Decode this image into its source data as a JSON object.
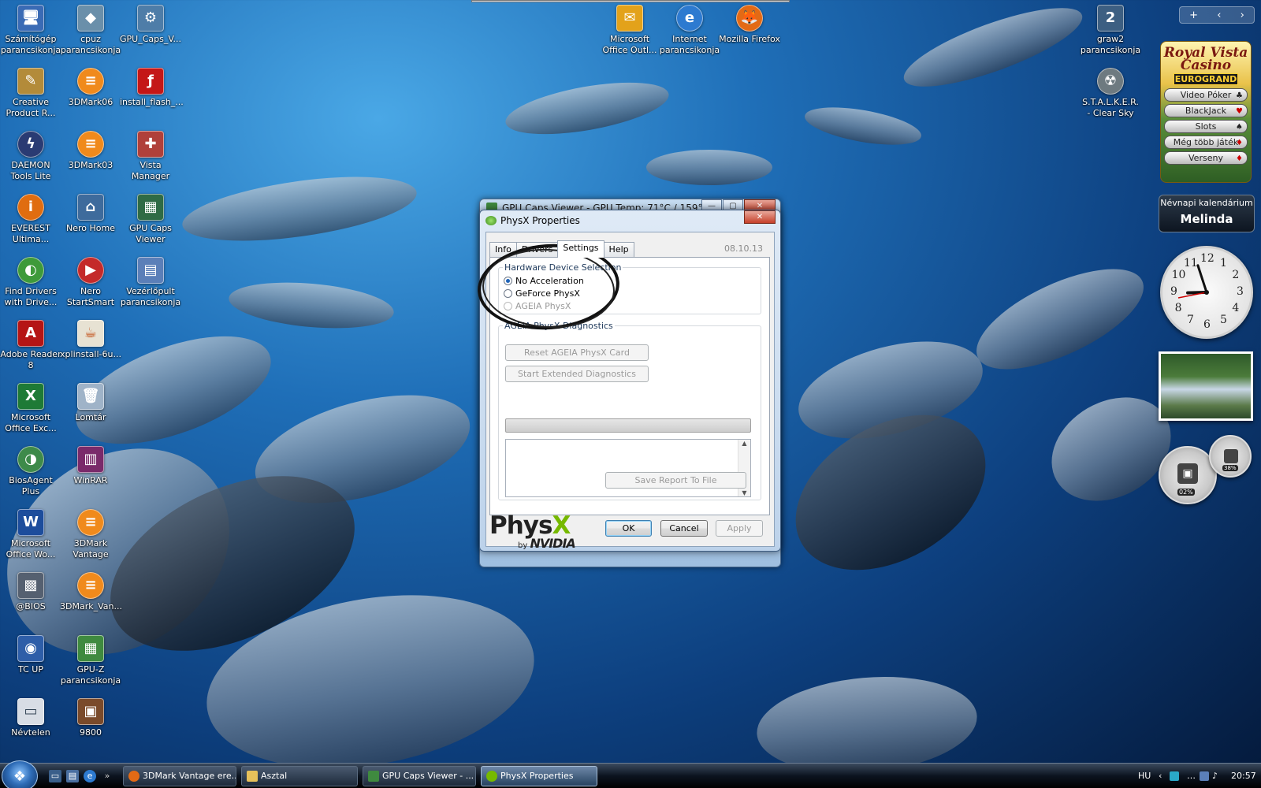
{
  "desktop_icons": [
    {
      "label": "Számítógép parancsikonja",
      "glyph": "🖥",
      "color": "#3a6bb5"
    },
    {
      "label": "cpuz parancsikonja",
      "glyph": "◆",
      "color": "#6a8faa"
    },
    {
      "label": "GPU_Caps_V...",
      "glyph": "⚙",
      "color": "#4e7da8"
    },
    {
      "label": "Creative Product R...",
      "glyph": "✎",
      "color": "#b38b3a"
    },
    {
      "label": "3DMark06",
      "glyph": "≡",
      "color": "#f08a1c"
    },
    {
      "label": "install_flash_...",
      "glyph": "ƒ",
      "color": "#c41717"
    },
    {
      "label": "DAEMON Tools Lite",
      "glyph": "ϟ",
      "color": "#2a3b73"
    },
    {
      "label": "3DMark03",
      "glyph": "≡",
      "color": "#f08a1c"
    },
    {
      "label": "Vista Manager",
      "glyph": "✚",
      "color": "#b0403a"
    },
    {
      "label": "EVEREST Ultima...",
      "glyph": "i",
      "color": "#e06d10"
    },
    {
      "label": "Nero Home",
      "glyph": "⌂",
      "color": "#3e6b9c"
    },
    {
      "label": "GPU Caps Viewer",
      "glyph": "▦",
      "color": "#2f6b45"
    },
    {
      "label": "Find Drivers with Drive...",
      "glyph": "◐",
      "color": "#3e9a3a"
    },
    {
      "label": "Nero StartSmart",
      "glyph": "▶",
      "color": "#c42a2a"
    },
    {
      "label": "Vezérlőpult parancsikonja",
      "glyph": "▤",
      "color": "#5b7fb8"
    },
    {
      "label": "Adobe Reader 8",
      "glyph": "A",
      "color": "#b51515"
    },
    {
      "label": "xplinstall-6u...",
      "glyph": "☕",
      "color": "#e7e2d3"
    },
    {
      "label": "Microsoft Office Exc...",
      "glyph": "X",
      "color": "#1e7a36"
    },
    {
      "label": "Lomtár",
      "glyph": "🗑",
      "color": "#9fb3c8"
    },
    {
      "label": "BiosAgent Plus",
      "glyph": "◑",
      "color": "#3e8a4a"
    },
    {
      "label": "WinRAR",
      "glyph": "▥",
      "color": "#7a2a6a"
    },
    {
      "label": "Microsoft Office Wo...",
      "glyph": "W",
      "color": "#1d4d9c"
    },
    {
      "label": "3DMark Vantage",
      "glyph": "≡",
      "color": "#f08a1c"
    },
    {
      "label": "@BIOS",
      "glyph": "▩",
      "color": "#556070"
    },
    {
      "label": "3DMark_Van...",
      "glyph": "≡",
      "color": "#f08a1c"
    },
    {
      "label": "TC UP",
      "glyph": "◉",
      "color": "#2e5ea8"
    },
    {
      "label": "GPU-Z parancsikonja",
      "glyph": "▦",
      "color": "#3f8a3f"
    },
    {
      "label": "Névtelen",
      "glyph": "▭",
      "color": "#d8dde5"
    },
    {
      "label": "9800",
      "glyph": "▣",
      "color": "#7a4a2a"
    }
  ],
  "top_icons": [
    {
      "label": "Microsoft Office Outl...",
      "glyph": "✉",
      "color": "#e3a21a"
    },
    {
      "label": "Internet parancsikonja",
      "glyph": "e",
      "color": "#2d7ad0"
    },
    {
      "label": "Mozilla Firefox",
      "glyph": "🦊",
      "color": "#e36a15"
    }
  ],
  "right_icons": [
    {
      "label": "graw2 parancsikonja",
      "glyph": "2",
      "color": "#3d5f82"
    },
    {
      "label": "S.T.A.L.K.E.R. - Clear Sky",
      "glyph": "☢",
      "color": "#6e7a80"
    }
  ],
  "sidebar": {
    "controls": {
      "add": "+",
      "prev": "‹",
      "next": "›"
    },
    "casino": {
      "title": "Royal Vista Casino",
      "brand": "EUROGRAND",
      "buttons": [
        {
          "label": "Video Póker",
          "suit": "♣"
        },
        {
          "label": "BlackJack",
          "suit": "♥"
        },
        {
          "label": "Slots",
          "suit": "♠"
        },
        {
          "label": "Még több játék",
          "suit": "♦"
        },
        {
          "label": "Verseny",
          "suit": "♦"
        }
      ]
    },
    "nevnap": {
      "title": "Névnapi kalendárium",
      "name": "Melinda"
    },
    "clock": {
      "numbers": [
        "12",
        "1",
        "2",
        "3",
        "4",
        "5",
        "6",
        "7",
        "8",
        "9",
        "10",
        "11"
      ],
      "hour": 8,
      "minute": 57
    },
    "meters": {
      "cpu": "02%",
      "ram": "38%"
    }
  },
  "back_window": {
    "title": "GPU Caps Viewer - GPU Temp: 71°C / 159°F",
    "minimize": "—",
    "maximize": "▢",
    "close": "✕"
  },
  "dialog": {
    "title": "PhysX Properties",
    "close": "✕",
    "tabs": [
      "Info",
      "Drivers",
      "Settings",
      "Help"
    ],
    "active_tab": "Settings",
    "version": "08.10.13",
    "hardware_group": "Hardware Device Selection",
    "options": [
      {
        "label": "No Acceleration",
        "selected": true,
        "disabled": false
      },
      {
        "label": "GeForce PhysX",
        "selected": false,
        "disabled": false
      },
      {
        "label": "AGEIA PhysX",
        "selected": false,
        "disabled": true
      }
    ],
    "diagnostics_group": "AGEIA PhysX Diagnostics",
    "reset_button": "Reset AGEIA PhysX Card",
    "extended_button": "Start Extended Diagnostics",
    "save_report_button": "Save Report To File",
    "ok": "OK",
    "cancel": "Cancel",
    "apply": "Apply",
    "logo_big": "PhysX",
    "logo_by": "by",
    "logo_brand": "NVIDIA"
  },
  "taskbar": {
    "start_glyph": "❖",
    "tasks": [
      {
        "label": "3DMark Vantage ere...",
        "color": "#e36a15",
        "active": false
      },
      {
        "label": "Asztal",
        "color": "#e7c15a",
        "active": false
      },
      {
        "label": "GPU Caps Viewer - ...",
        "color": "#3f8a3f",
        "active": false
      },
      {
        "label": "PhysX Properties",
        "color": "#76b900",
        "active": true
      }
    ],
    "language": "HU",
    "time": "20:57"
  }
}
